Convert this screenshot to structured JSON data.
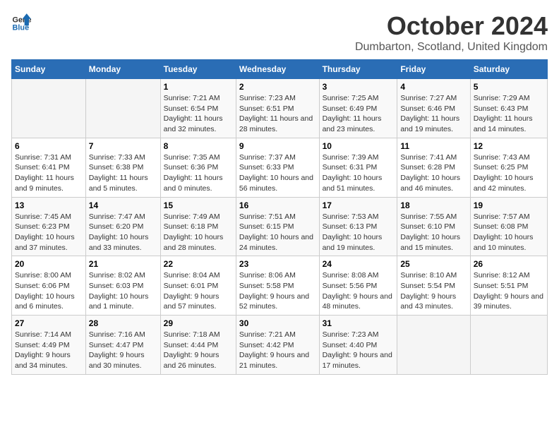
{
  "logo": {
    "general": "General",
    "blue": "Blue",
    "tagline": ""
  },
  "title": "October 2024",
  "subtitle": "Dumbarton, Scotland, United Kingdom",
  "weekdays": [
    "Sunday",
    "Monday",
    "Tuesday",
    "Wednesday",
    "Thursday",
    "Friday",
    "Saturday"
  ],
  "weeks": [
    [
      {
        "day": "",
        "sunrise": "",
        "sunset": "",
        "daylight": ""
      },
      {
        "day": "",
        "sunrise": "",
        "sunset": "",
        "daylight": ""
      },
      {
        "day": "1",
        "sunrise": "Sunrise: 7:21 AM",
        "sunset": "Sunset: 6:54 PM",
        "daylight": "Daylight: 11 hours and 32 minutes."
      },
      {
        "day": "2",
        "sunrise": "Sunrise: 7:23 AM",
        "sunset": "Sunset: 6:51 PM",
        "daylight": "Daylight: 11 hours and 28 minutes."
      },
      {
        "day": "3",
        "sunrise": "Sunrise: 7:25 AM",
        "sunset": "Sunset: 6:49 PM",
        "daylight": "Daylight: 11 hours and 23 minutes."
      },
      {
        "day": "4",
        "sunrise": "Sunrise: 7:27 AM",
        "sunset": "Sunset: 6:46 PM",
        "daylight": "Daylight: 11 hours and 19 minutes."
      },
      {
        "day": "5",
        "sunrise": "Sunrise: 7:29 AM",
        "sunset": "Sunset: 6:43 PM",
        "daylight": "Daylight: 11 hours and 14 minutes."
      }
    ],
    [
      {
        "day": "6",
        "sunrise": "Sunrise: 7:31 AM",
        "sunset": "Sunset: 6:41 PM",
        "daylight": "Daylight: 11 hours and 9 minutes."
      },
      {
        "day": "7",
        "sunrise": "Sunrise: 7:33 AM",
        "sunset": "Sunset: 6:38 PM",
        "daylight": "Daylight: 11 hours and 5 minutes."
      },
      {
        "day": "8",
        "sunrise": "Sunrise: 7:35 AM",
        "sunset": "Sunset: 6:36 PM",
        "daylight": "Daylight: 11 hours and 0 minutes."
      },
      {
        "day": "9",
        "sunrise": "Sunrise: 7:37 AM",
        "sunset": "Sunset: 6:33 PM",
        "daylight": "Daylight: 10 hours and 56 minutes."
      },
      {
        "day": "10",
        "sunrise": "Sunrise: 7:39 AM",
        "sunset": "Sunset: 6:31 PM",
        "daylight": "Daylight: 10 hours and 51 minutes."
      },
      {
        "day": "11",
        "sunrise": "Sunrise: 7:41 AM",
        "sunset": "Sunset: 6:28 PM",
        "daylight": "Daylight: 10 hours and 46 minutes."
      },
      {
        "day": "12",
        "sunrise": "Sunrise: 7:43 AM",
        "sunset": "Sunset: 6:25 PM",
        "daylight": "Daylight: 10 hours and 42 minutes."
      }
    ],
    [
      {
        "day": "13",
        "sunrise": "Sunrise: 7:45 AM",
        "sunset": "Sunset: 6:23 PM",
        "daylight": "Daylight: 10 hours and 37 minutes."
      },
      {
        "day": "14",
        "sunrise": "Sunrise: 7:47 AM",
        "sunset": "Sunset: 6:20 PM",
        "daylight": "Daylight: 10 hours and 33 minutes."
      },
      {
        "day": "15",
        "sunrise": "Sunrise: 7:49 AM",
        "sunset": "Sunset: 6:18 PM",
        "daylight": "Daylight: 10 hours and 28 minutes."
      },
      {
        "day": "16",
        "sunrise": "Sunrise: 7:51 AM",
        "sunset": "Sunset: 6:15 PM",
        "daylight": "Daylight: 10 hours and 24 minutes."
      },
      {
        "day": "17",
        "sunrise": "Sunrise: 7:53 AM",
        "sunset": "Sunset: 6:13 PM",
        "daylight": "Daylight: 10 hours and 19 minutes."
      },
      {
        "day": "18",
        "sunrise": "Sunrise: 7:55 AM",
        "sunset": "Sunset: 6:10 PM",
        "daylight": "Daylight: 10 hours and 15 minutes."
      },
      {
        "day": "19",
        "sunrise": "Sunrise: 7:57 AM",
        "sunset": "Sunset: 6:08 PM",
        "daylight": "Daylight: 10 hours and 10 minutes."
      }
    ],
    [
      {
        "day": "20",
        "sunrise": "Sunrise: 8:00 AM",
        "sunset": "Sunset: 6:06 PM",
        "daylight": "Daylight: 10 hours and 6 minutes."
      },
      {
        "day": "21",
        "sunrise": "Sunrise: 8:02 AM",
        "sunset": "Sunset: 6:03 PM",
        "daylight": "Daylight: 10 hours and 1 minute."
      },
      {
        "day": "22",
        "sunrise": "Sunrise: 8:04 AM",
        "sunset": "Sunset: 6:01 PM",
        "daylight": "Daylight: 9 hours and 57 minutes."
      },
      {
        "day": "23",
        "sunrise": "Sunrise: 8:06 AM",
        "sunset": "Sunset: 5:58 PM",
        "daylight": "Daylight: 9 hours and 52 minutes."
      },
      {
        "day": "24",
        "sunrise": "Sunrise: 8:08 AM",
        "sunset": "Sunset: 5:56 PM",
        "daylight": "Daylight: 9 hours and 48 minutes."
      },
      {
        "day": "25",
        "sunrise": "Sunrise: 8:10 AM",
        "sunset": "Sunset: 5:54 PM",
        "daylight": "Daylight: 9 hours and 43 minutes."
      },
      {
        "day": "26",
        "sunrise": "Sunrise: 8:12 AM",
        "sunset": "Sunset: 5:51 PM",
        "daylight": "Daylight: 9 hours and 39 minutes."
      }
    ],
    [
      {
        "day": "27",
        "sunrise": "Sunrise: 7:14 AM",
        "sunset": "Sunset: 4:49 PM",
        "daylight": "Daylight: 9 hours and 34 minutes."
      },
      {
        "day": "28",
        "sunrise": "Sunrise: 7:16 AM",
        "sunset": "Sunset: 4:47 PM",
        "daylight": "Daylight: 9 hours and 30 minutes."
      },
      {
        "day": "29",
        "sunrise": "Sunrise: 7:18 AM",
        "sunset": "Sunset: 4:44 PM",
        "daylight": "Daylight: 9 hours and 26 minutes."
      },
      {
        "day": "30",
        "sunrise": "Sunrise: 7:21 AM",
        "sunset": "Sunset: 4:42 PM",
        "daylight": "Daylight: 9 hours and 21 minutes."
      },
      {
        "day": "31",
        "sunrise": "Sunrise: 7:23 AM",
        "sunset": "Sunset: 4:40 PM",
        "daylight": "Daylight: 9 hours and 17 minutes."
      },
      {
        "day": "",
        "sunrise": "",
        "sunset": "",
        "daylight": ""
      },
      {
        "day": "",
        "sunrise": "",
        "sunset": "",
        "daylight": ""
      }
    ]
  ]
}
